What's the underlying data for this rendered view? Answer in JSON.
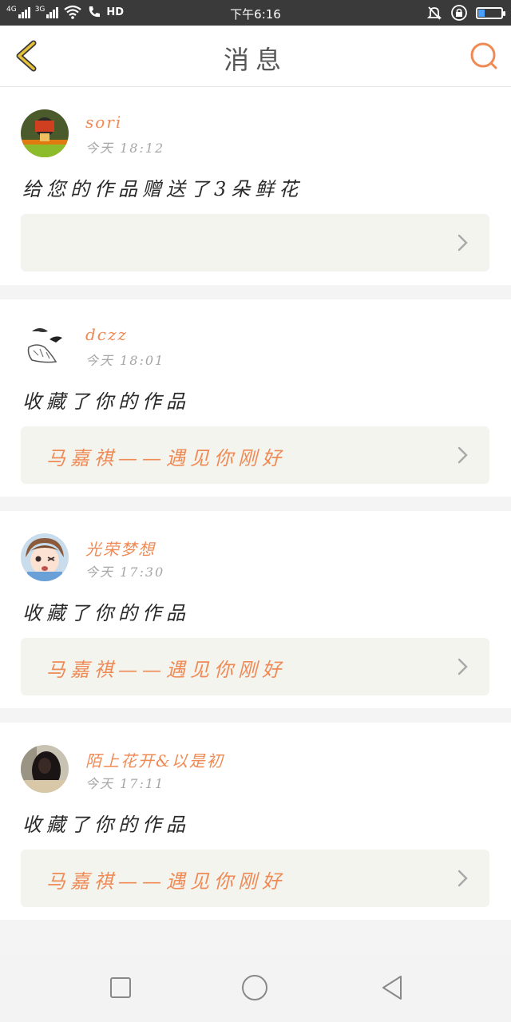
{
  "status_bar": {
    "network_1": "4G",
    "network_2": "3G",
    "hd": "HD",
    "time": "下午6:16",
    "battery_level": 0.3,
    "icons": [
      "signal-icon",
      "wifi-icon",
      "call-icon",
      "mute-bell-icon",
      "rotation-lock-icon",
      "battery-icon"
    ]
  },
  "header": {
    "title": "消息",
    "back_icon": "chevron-left-icon",
    "search_icon": "search-icon"
  },
  "colors": {
    "accent": "#ef8a55",
    "back_icon": "#e8c23a",
    "text": "#2a2a2a",
    "muted": "#a6a6a6",
    "box_bg": "#f4f4ef"
  },
  "messages": [
    {
      "user": "sori",
      "time": "今天 18:12",
      "text": "给您的作品赠送了3朵鲜花",
      "work_title": ""
    },
    {
      "user": "dczz",
      "time": "今天 18:01",
      "text": "收藏了你的作品",
      "work_title": "马嘉祺——遇见你刚好"
    },
    {
      "user": "光荣梦想",
      "time": "今天 17:30",
      "text": "收藏了你的作品",
      "work_title": "马嘉祺——遇见你刚好"
    },
    {
      "user": "陌上花开&以是初",
      "time": "今天 17:11",
      "text": "收藏了你的作品",
      "work_title": "马嘉祺——遇见你刚好"
    }
  ],
  "nav_bar": {
    "icons": [
      "recent-apps-icon",
      "home-icon",
      "back-icon"
    ]
  }
}
